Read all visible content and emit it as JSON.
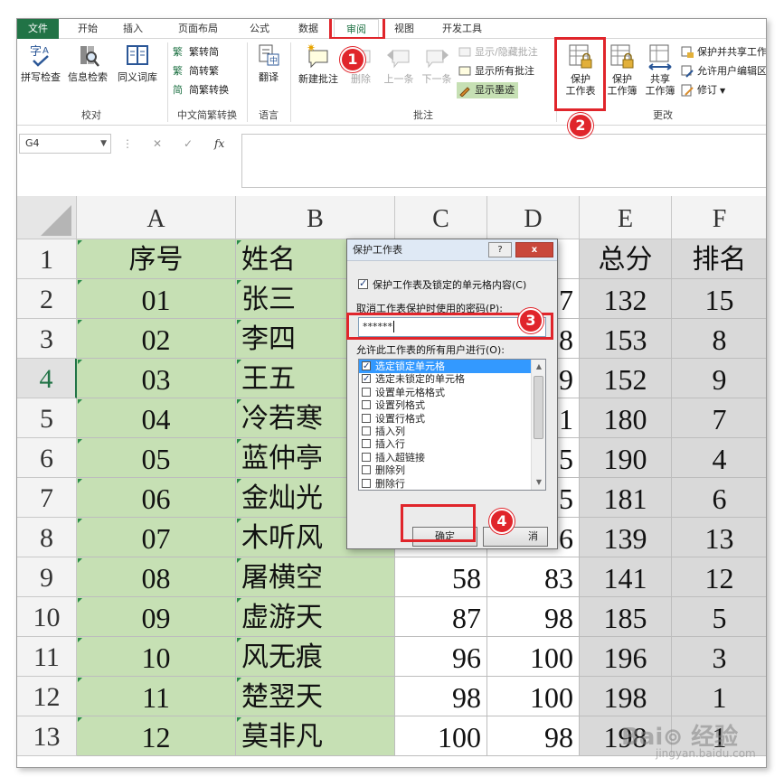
{
  "tabs": [
    "文件",
    "开始",
    "插入",
    "页面布局",
    "公式",
    "数据",
    "审阅",
    "视图",
    "开发工具"
  ],
  "ribbon": {
    "proofing": {
      "title": "校对",
      "spell": "拼写检查",
      "research": "信息检索",
      "thesaurus": "同义词库"
    },
    "chinese": {
      "title": "中文简繁转换",
      "to_trad": "繁转简",
      "to_simp": "简转繁",
      "convert": "简繁转换"
    },
    "language": {
      "title": "语言",
      "translate": "翻译"
    },
    "comments": {
      "title": "批注",
      "new": "新建批注",
      "delete": "删除",
      "prev": "上一条",
      "next": "下一条",
      "show_hide": "显示/隐藏批注",
      "show_all": "显示所有批注",
      "show_ink": "显示墨迹"
    },
    "changes": {
      "title": "更改",
      "protect_sheet": [
        "保护",
        "工作表"
      ],
      "protect_book": [
        "保护",
        "工作簿"
      ],
      "share_book": [
        "共享",
        "工作簿"
      ],
      "protect_share": "保护并共享工作",
      "allow_edit": "允许用户编辑区",
      "track": "修订"
    }
  },
  "formula_bar": {
    "name_box": "G4",
    "fx": "fx"
  },
  "columns": [
    "A",
    "B",
    "C",
    "D",
    "E",
    "F"
  ],
  "rows": [
    {
      "n": "1",
      "a": "序号",
      "b": "姓名",
      "c": "",
      "d": "",
      "e": "总分",
      "f": "排名"
    },
    {
      "n": "2",
      "a": "01",
      "b": "张三",
      "c": "",
      "d": "7",
      "e": "132",
      "f": "15"
    },
    {
      "n": "3",
      "a": "02",
      "b": "李四",
      "c": "",
      "d": "8",
      "e": "153",
      "f": "8"
    },
    {
      "n": "4",
      "a": "03",
      "b": "王五",
      "c": "",
      "d": "9",
      "e": "152",
      "f": "9"
    },
    {
      "n": "5",
      "a": "04",
      "b": "冷若寒",
      "c": "",
      "d": "1",
      "e": "180",
      "f": "7"
    },
    {
      "n": "6",
      "a": "05",
      "b": "蓝仲亭",
      "c": "",
      "d": "5",
      "e": "190",
      "f": "4"
    },
    {
      "n": "7",
      "a": "06",
      "b": "金灿光",
      "c": "",
      "d": "5",
      "e": "181",
      "f": "6"
    },
    {
      "n": "8",
      "a": "07",
      "b": "木听风",
      "c": "",
      "d": "6",
      "e": "139",
      "f": "13"
    },
    {
      "n": "9",
      "a": "08",
      "b": "屠横空",
      "c": "58",
      "d": "83",
      "e": "141",
      "f": "12"
    },
    {
      "n": "10",
      "a": "09",
      "b": "虚游天",
      "c": "87",
      "d": "98",
      "e": "185",
      "f": "5"
    },
    {
      "n": "11",
      "a": "10",
      "b": "风无痕",
      "c": "96",
      "d": "100",
      "e": "196",
      "f": "3"
    },
    {
      "n": "12",
      "a": "11",
      "b": "楚翌天",
      "c": "98",
      "d": "100",
      "e": "198",
      "f": "1"
    },
    {
      "n": "13",
      "a": "12",
      "b": "莫非凡",
      "c": "100",
      "d": "98",
      "e": "198",
      "f": "1"
    }
  ],
  "dialog": {
    "title": "保护工作表",
    "help": "?",
    "close": "x",
    "protect_label": "保护工作表及锁定的单元格内容(C)",
    "password_label": "取消工作表保护时使用的密码(P):",
    "password_value": "******",
    "allow_label": "允许此工作表的所有用户进行(O):",
    "options": [
      {
        "label": "选定锁定单元格",
        "checked": true
      },
      {
        "label": "选定未锁定的单元格",
        "checked": true
      },
      {
        "label": "设置单元格格式",
        "checked": false
      },
      {
        "label": "设置列格式",
        "checked": false
      },
      {
        "label": "设置行格式",
        "checked": false
      },
      {
        "label": "插入列",
        "checked": false
      },
      {
        "label": "插入行",
        "checked": false
      },
      {
        "label": "插入超链接",
        "checked": false
      },
      {
        "label": "删除列",
        "checked": false
      },
      {
        "label": "删除行",
        "checked": false
      }
    ],
    "ok": "确定",
    "cancel": "消"
  },
  "badges": [
    "1",
    "2",
    "3",
    "4"
  ],
  "watermark": {
    "brand": "Bai⊚ 经验",
    "url": "jingyan.baidu.com"
  },
  "colors": {
    "excel_green": "#217346",
    "header_fill": "#c6e0b4",
    "data_fill": "#d9d9d9",
    "highlight_red": "#e0252b"
  }
}
